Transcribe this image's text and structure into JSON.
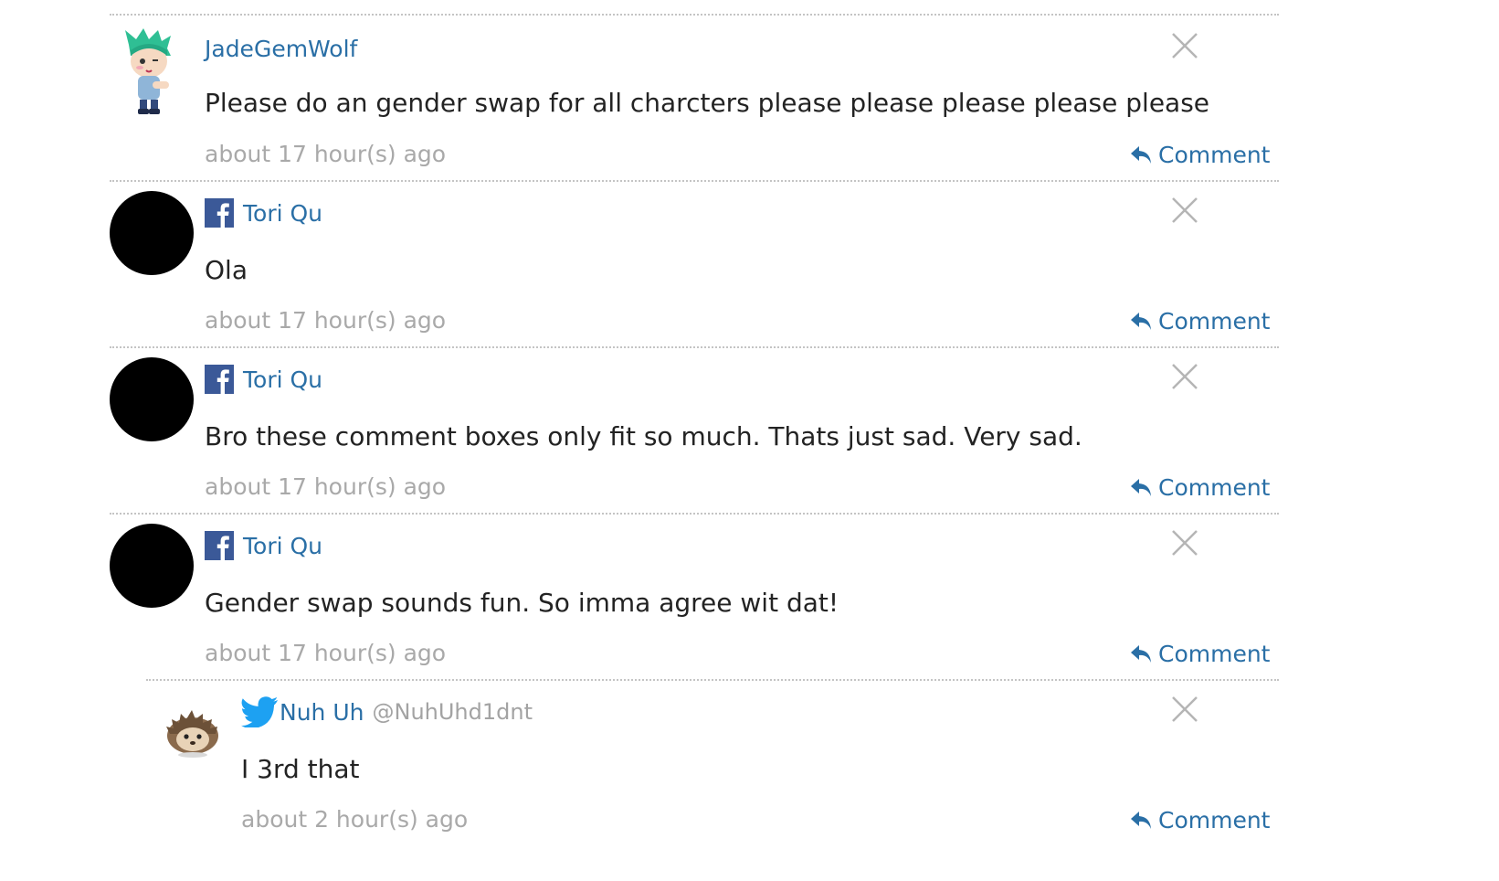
{
  "comments": [
    {
      "author": "JadeGemWolf",
      "avatar": "anime-character-avatar",
      "text": "Please do an gender swap for all charcters please please please please please",
      "time": "about 17 hour(s) ago",
      "reply_label": "Comment"
    },
    {
      "author": "Tori Qu",
      "network": "facebook",
      "avatar": "black-circle-avatar",
      "text": "Ola",
      "time": "about 17 hour(s) ago",
      "reply_label": "Comment"
    },
    {
      "author": "Tori Qu",
      "network": "facebook",
      "avatar": "black-circle-avatar",
      "text": "Bro these comment boxes only fit so much. Thats just sad. Very sad.",
      "time": "about 17 hour(s) ago",
      "reply_label": "Comment"
    },
    {
      "author": "Tori Qu",
      "network": "facebook",
      "avatar": "black-circle-avatar",
      "text": "Gender swap sounds fun. So imma agree wit dat!",
      "time": "about 17 hour(s) ago",
      "reply_label": "Comment"
    },
    {
      "author": "Nuh Uh",
      "handle": "@NuhUhd1dnt",
      "network": "twitter",
      "avatar": "hedgehog-avatar",
      "text": "I 3rd that",
      "time": "about 2 hour(s) ago",
      "reply_label": "Comment"
    }
  ],
  "icons": {
    "close": "close-icon",
    "reply": "reply-arrow-icon",
    "facebook": "facebook-icon",
    "twitter": "twitter-icon"
  },
  "colors": {
    "link": "#2a6fa6",
    "muted": "#a9a9a9",
    "text": "#232323",
    "facebook": "#3b5998",
    "twitter": "#1da1f2",
    "divider": "#c4c4c4",
    "close": "#b5b5b5"
  }
}
